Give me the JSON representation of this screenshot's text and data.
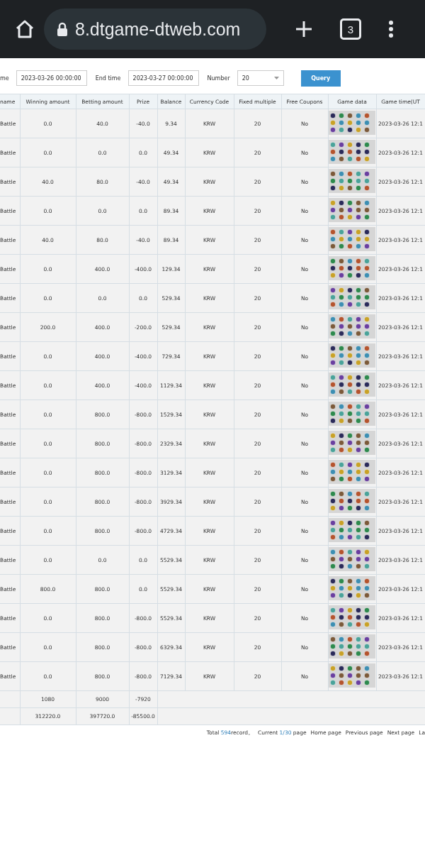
{
  "browser": {
    "url": "8.dtgame-dtweb.com",
    "tab_count": "3"
  },
  "filters": {
    "start_label": "me",
    "start_value": "2023-03-26 00:00:00",
    "end_label": "End time",
    "end_value": "2023-03-27 00:00:00",
    "number_label": "Number",
    "number_value": "20",
    "query_button": "Query"
  },
  "table": {
    "columns": [
      "name",
      "Winning amount",
      "Betting amount",
      "Prize",
      "Balance",
      "Currency Code",
      "Fixed multiple",
      "Free Coupons",
      "Game data",
      "Game time(UT"
    ],
    "rows": [
      {
        "name": "Battle",
        "winning": "0.0",
        "betting": "40.0",
        "prize": "-40.0",
        "balance": "9.34",
        "currency": "KRW",
        "multiple": "20",
        "coupons": "No",
        "time": "2023-03-26 12:1"
      },
      {
        "name": "Battle",
        "winning": "0.0",
        "betting": "0.0",
        "prize": "0.0",
        "balance": "49.34",
        "currency": "KRW",
        "multiple": "20",
        "coupons": "No",
        "time": "2023-03-26 12:1"
      },
      {
        "name": "Battle",
        "winning": "40.0",
        "betting": "80.0",
        "prize": "-40.0",
        "balance": "49.34",
        "currency": "KRW",
        "multiple": "20",
        "coupons": "No",
        "time": "2023-03-26 12:1"
      },
      {
        "name": "Battle",
        "winning": "0.0",
        "betting": "0.0",
        "prize": "0.0",
        "balance": "89.34",
        "currency": "KRW",
        "multiple": "20",
        "coupons": "No",
        "time": "2023-03-26 12:1"
      },
      {
        "name": "Battle",
        "winning": "40.0",
        "betting": "80.0",
        "prize": "-40.0",
        "balance": "89.34",
        "currency": "KRW",
        "multiple": "20",
        "coupons": "No",
        "time": "2023-03-26 12:1"
      },
      {
        "name": "Battle",
        "winning": "0.0",
        "betting": "400.0",
        "prize": "-400.0",
        "balance": "129.34",
        "currency": "KRW",
        "multiple": "20",
        "coupons": "No",
        "time": "2023-03-26 12:1"
      },
      {
        "name": "Battle",
        "winning": "0.0",
        "betting": "0.0",
        "prize": "0.0",
        "balance": "529.34",
        "currency": "KRW",
        "multiple": "20",
        "coupons": "No",
        "time": "2023-03-26 12:1"
      },
      {
        "name": "Battle",
        "winning": "200.0",
        "betting": "400.0",
        "prize": "-200.0",
        "balance": "529.34",
        "currency": "KRW",
        "multiple": "20",
        "coupons": "No",
        "time": "2023-03-26 12:1"
      },
      {
        "name": "Battle",
        "winning": "0.0",
        "betting": "400.0",
        "prize": "-400.0",
        "balance": "729.34",
        "currency": "KRW",
        "multiple": "20",
        "coupons": "No",
        "time": "2023-03-26 12:1"
      },
      {
        "name": "Battle",
        "winning": "0.0",
        "betting": "400.0",
        "prize": "-400.0",
        "balance": "1129.34",
        "currency": "KRW",
        "multiple": "20",
        "coupons": "No",
        "time": "2023-03-26 12:1"
      },
      {
        "name": "Battle",
        "winning": "0.0",
        "betting": "800.0",
        "prize": "-800.0",
        "balance": "1529.34",
        "currency": "KRW",
        "multiple": "20",
        "coupons": "No",
        "time": "2023-03-26 12:1"
      },
      {
        "name": "Battle",
        "winning": "0.0",
        "betting": "800.0",
        "prize": "-800.0",
        "balance": "2329.34",
        "currency": "KRW",
        "multiple": "20",
        "coupons": "No",
        "time": "2023-03-26 12:1"
      },
      {
        "name": "Battle",
        "winning": "0.0",
        "betting": "800.0",
        "prize": "-800.0",
        "balance": "3129.34",
        "currency": "KRW",
        "multiple": "20",
        "coupons": "No",
        "time": "2023-03-26 12:1"
      },
      {
        "name": "Battle",
        "winning": "0.0",
        "betting": "800.0",
        "prize": "-800.0",
        "balance": "3929.34",
        "currency": "KRW",
        "multiple": "20",
        "coupons": "No",
        "time": "2023-03-26 12:1"
      },
      {
        "name": "Battle",
        "winning": "0.0",
        "betting": "800.0",
        "prize": "-800.0",
        "balance": "4729.34",
        "currency": "KRW",
        "multiple": "20",
        "coupons": "No",
        "time": "2023-03-26 12:1"
      },
      {
        "name": "Battle",
        "winning": "0.0",
        "betting": "0.0",
        "prize": "0.0",
        "balance": "5529.34",
        "currency": "KRW",
        "multiple": "20",
        "coupons": "No",
        "time": "2023-03-26 12:1"
      },
      {
        "name": "Battle",
        "winning": "800.0",
        "betting": "800.0",
        "prize": "0.0",
        "balance": "5529.34",
        "currency": "KRW",
        "multiple": "20",
        "coupons": "No",
        "time": "2023-03-26 12:1"
      },
      {
        "name": "Battle",
        "winning": "0.0",
        "betting": "800.0",
        "prize": "-800.0",
        "balance": "5529.34",
        "currency": "KRW",
        "multiple": "20",
        "coupons": "No",
        "time": "2023-03-26 12:1"
      },
      {
        "name": "Battle",
        "winning": "0.0",
        "betting": "800.0",
        "prize": "-800.0",
        "balance": "6329.34",
        "currency": "KRW",
        "multiple": "20",
        "coupons": "No",
        "time": "2023-03-26 12:1"
      },
      {
        "name": "Battle",
        "winning": "0.0",
        "betting": "800.0",
        "prize": "-800.0",
        "balance": "7129.34",
        "currency": "KRW",
        "multiple": "20",
        "coupons": "No",
        "time": "2023-03-26 12:1"
      }
    ],
    "subtotal": {
      "winning": "1080",
      "betting": "9000",
      "prize": "-7920"
    },
    "total": {
      "winning": "312220.0",
      "betting": "397720.0",
      "prize": "-85500.0"
    }
  },
  "pagination": {
    "total_prefix": "Total",
    "total_count": "594",
    "total_suffix": "record。",
    "current_prefix": "Current",
    "current_page": "1/30",
    "current_suffix": "page",
    "links": [
      "Home page",
      "Previous page",
      "Next page",
      "La"
    ]
  }
}
